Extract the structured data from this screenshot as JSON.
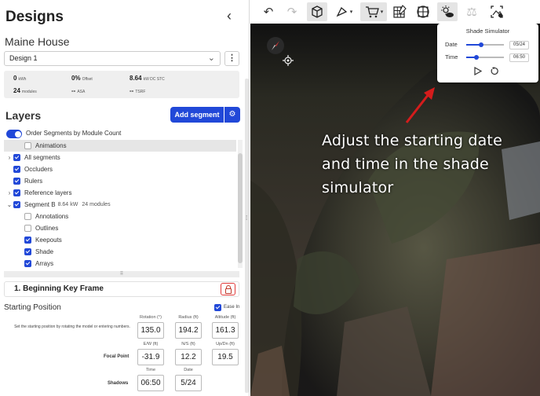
{
  "panel": {
    "title": "Designs",
    "project_name": "Maine House",
    "design_select": "Design 1",
    "stats": [
      {
        "value": "0",
        "unit": "kWh"
      },
      {
        "value": "0%",
        "unit": "Offset"
      },
      {
        "value": "8.64",
        "unit": "kW DC STC"
      },
      {
        "value": "24",
        "unit": "modules"
      },
      {
        "value": "--",
        "unit": "ASA"
      },
      {
        "value": "--",
        "unit": "TSRF"
      }
    ]
  },
  "layers": {
    "title": "Layers",
    "add_segment_label": "Add segment",
    "order_toggle_label": "Order Segments by Module Count",
    "items": [
      {
        "label": "Animations",
        "checked": false,
        "caret": "",
        "indent": 1,
        "highlighted": true
      },
      {
        "label": "All segments",
        "checked": true,
        "caret": "›",
        "indent": 0
      },
      {
        "label": "Occluders",
        "checked": true,
        "caret": "",
        "indent": 0
      },
      {
        "label": "Rulers",
        "checked": true,
        "caret": "",
        "indent": 0
      },
      {
        "label": "Reference layers",
        "checked": true,
        "caret": "›",
        "indent": 0
      },
      {
        "label": "Segment B",
        "checked": true,
        "caret": "⌄",
        "indent": 0,
        "meta_kw": "8.64",
        "meta_kw_unit": "kW",
        "meta_mod": "24",
        "meta_mod_unit": "modules"
      },
      {
        "label": "Annotations",
        "checked": false,
        "caret": "",
        "indent": 1
      },
      {
        "label": "Outlines",
        "checked": false,
        "caret": "",
        "indent": 1
      },
      {
        "label": "Keepouts",
        "checked": true,
        "caret": "",
        "indent": 1
      },
      {
        "label": "Shade",
        "checked": true,
        "caret": "",
        "indent": 1
      },
      {
        "label": "Arrays",
        "checked": true,
        "caret": "",
        "indent": 1
      }
    ]
  },
  "keyframe": {
    "title": "1. Beginning Key Frame"
  },
  "starting_position": {
    "title": "Starting Position",
    "ease_in_label": "Ease In",
    "description": "Set the starting position by rotating the model or entering numbers.",
    "headers_row1": [
      "Rotation (°)",
      "Radius (ft)",
      "Altitude (ft)"
    ],
    "values_row1": [
      "135.0",
      "194.2",
      "161.3"
    ],
    "focal_label": "Focal Point",
    "headers_row2": [
      "E/W (ft)",
      "N/S (ft)",
      "Up/Dn (ft)"
    ],
    "values_row2": [
      "-31.9",
      "12.2",
      "19.5"
    ],
    "shadows_label": "Shadows",
    "headers_row3": [
      "Time",
      "Date"
    ],
    "values_row3": [
      "06:50",
      "5/24"
    ]
  },
  "shade_simulator": {
    "title": "Shade Simulator",
    "date_label": "Date",
    "date_value": "05/24",
    "date_fraction": 0.4,
    "time_label": "Time",
    "time_value": "06:50",
    "time_fraction": 0.28
  },
  "overlay": {
    "text": "Adjust the starting date and time in the shade simulator"
  },
  "colors": {
    "accent": "#2148d8",
    "highlight_red": "#e23b3b"
  }
}
